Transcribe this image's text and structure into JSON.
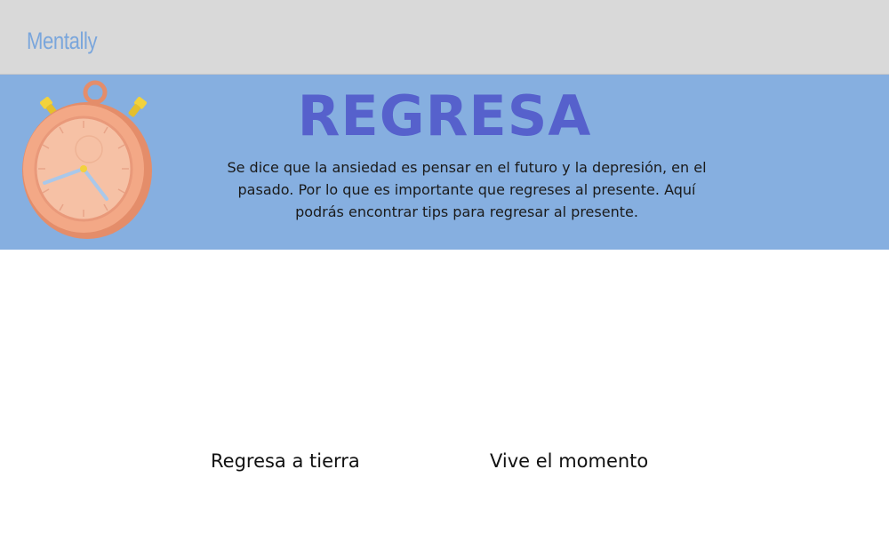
{
  "header": {
    "brand": "Mentally"
  },
  "hero": {
    "title": "REGRESA",
    "description": "Se dice que la ansiedad es pensar en el futuro y la depresión, en el pasado. Por lo que es importante que regreses al presente. Aquí podrás encontrar tips para regresar al presente.",
    "image_icon": "stopwatch-icon"
  },
  "tips": [
    {
      "label": "Regresa a tierra"
    },
    {
      "label": "Vive el momento"
    }
  ],
  "colors": {
    "header_bg": "#d9d9d9",
    "brand": "#7aa6dc",
    "hero_bg": "#86afe0",
    "hero_title": "#5661cc",
    "stopwatch_body": "#f0a37c",
    "stopwatch_buttons": "#f2d23d"
  }
}
